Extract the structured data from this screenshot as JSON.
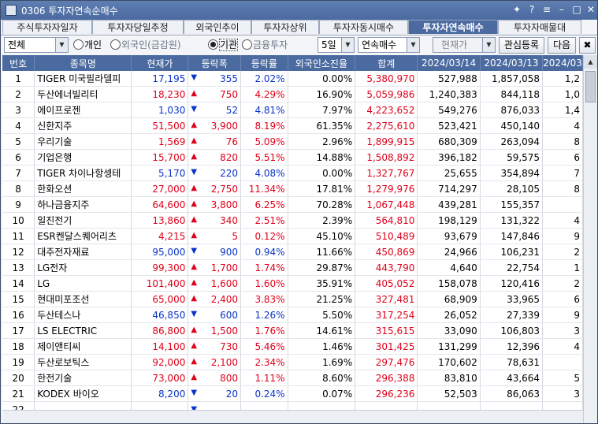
{
  "window": {
    "title": "0306 투자자연속순매수",
    "buttons": [
      "✦",
      "?",
      "≡",
      "–",
      "□",
      "✕"
    ]
  },
  "tabs": [
    {
      "label": "주식투자자일자",
      "active": false
    },
    {
      "label": "투자자당일추정",
      "active": false
    },
    {
      "label": "외국인추이",
      "active": false
    },
    {
      "label": "투자자상위",
      "active": false
    },
    {
      "label": "투자자동시매수",
      "active": false
    },
    {
      "label": "투자자연속매수",
      "active": true
    },
    {
      "label": "투자자매물대",
      "active": false
    }
  ],
  "toolbar": {
    "market_select": "전체",
    "radio_individual": "개인",
    "radio_foreign": "외국인(금감원)",
    "radio_institution": "기관",
    "radio_finance": "금융투자",
    "days_select": "5일",
    "mode_select": "연속매수",
    "price_select": "현재가",
    "watch_button": "관심등록",
    "next_button": "다음",
    "selected_radio": "institution"
  },
  "table": {
    "headers": [
      "번호",
      "종목명",
      "현재가",
      "등락폭",
      "등락률",
      "외국인소진율",
      "합계",
      "2024/03/14",
      "2024/03/13",
      "2024/03"
    ],
    "rows": [
      {
        "no": "1",
        "name": "TIGER 미국필라델피",
        "price": "17,195",
        "dir": "down",
        "chg": "355",
        "rate": "2.02%",
        "foreign": "0.00%",
        "sum": "5,380,970",
        "d1": "527,988",
        "d2": "1,857,058",
        "d3": "1,2"
      },
      {
        "no": "2",
        "name": "두산에너빌리티",
        "price": "18,230",
        "dir": "up",
        "chg": "750",
        "rate": "4.29%",
        "foreign": "16.90%",
        "sum": "5,059,986",
        "d1": "1,240,383",
        "d2": "844,118",
        "d3": "1,0"
      },
      {
        "no": "3",
        "name": "에이프로젠",
        "price": "1,030",
        "dir": "down",
        "chg": "52",
        "rate": "4.81%",
        "foreign": "7.97%",
        "sum": "4,223,652",
        "d1": "549,276",
        "d2": "876,033",
        "d3": "1,4"
      },
      {
        "no": "4",
        "name": "신한지주",
        "price": "51,500",
        "dir": "up",
        "chg": "3,900",
        "rate": "8.19%",
        "foreign": "61.35%",
        "sum": "2,275,610",
        "d1": "523,421",
        "d2": "450,140",
        "d3": "4"
      },
      {
        "no": "5",
        "name": "우리기술",
        "price": "1,569",
        "dir": "up",
        "chg": "76",
        "rate": "5.09%",
        "foreign": "2.96%",
        "sum": "1,899,915",
        "d1": "680,309",
        "d2": "263,094",
        "d3": "8"
      },
      {
        "no": "6",
        "name": "기업은행",
        "price": "15,700",
        "dir": "up",
        "chg": "820",
        "rate": "5.51%",
        "foreign": "14.88%",
        "sum": "1,508,892",
        "d1": "396,182",
        "d2": "59,575",
        "d3": "6"
      },
      {
        "no": "7",
        "name": "TIGER 차이나항셍테",
        "price": "5,170",
        "dir": "down",
        "chg": "220",
        "rate": "4.08%",
        "foreign": "0.00%",
        "sum": "1,327,767",
        "d1": "25,655",
        "d2": "354,894",
        "d3": "7"
      },
      {
        "no": "8",
        "name": "한화오션",
        "price": "27,000",
        "dir": "up",
        "chg": "2,750",
        "rate": "11.34%",
        "foreign": "17.81%",
        "sum": "1,279,976",
        "d1": "714,297",
        "d2": "28,105",
        "d3": "8"
      },
      {
        "no": "9",
        "name": "하나금융지주",
        "price": "64,600",
        "dir": "up",
        "chg": "3,800",
        "rate": "6.25%",
        "foreign": "70.28%",
        "sum": "1,067,448",
        "d1": "439,281",
        "d2": "155,357",
        "d3": ""
      },
      {
        "no": "10",
        "name": "일진전기",
        "price": "13,860",
        "dir": "up",
        "chg": "340",
        "rate": "2.51%",
        "foreign": "2.39%",
        "sum": "564,810",
        "d1": "198,129",
        "d2": "131,322",
        "d3": "4"
      },
      {
        "no": "11",
        "name": "ESR켄달스퀘어리츠",
        "price": "4,215",
        "dir": "up",
        "chg": "5",
        "rate": "0.12%",
        "foreign": "45.10%",
        "sum": "510,489",
        "d1": "93,679",
        "d2": "147,846",
        "d3": "9"
      },
      {
        "no": "12",
        "name": "대주전자재료",
        "price": "95,000",
        "dir": "down",
        "chg": "900",
        "rate": "0.94%",
        "foreign": "11.66%",
        "sum": "450,869",
        "d1": "24,966",
        "d2": "106,231",
        "d3": "2"
      },
      {
        "no": "13",
        "name": "LG전자",
        "price": "99,300",
        "dir": "up",
        "chg": "1,700",
        "rate": "1.74%",
        "foreign": "29.87%",
        "sum": "443,790",
        "d1": "4,640",
        "d2": "22,754",
        "d3": "1"
      },
      {
        "no": "14",
        "name": "LG",
        "price": "101,400",
        "dir": "up",
        "chg": "1,600",
        "rate": "1.60%",
        "foreign": "35.91%",
        "sum": "405,052",
        "d1": "158,078",
        "d2": "120,416",
        "d3": "2"
      },
      {
        "no": "15",
        "name": "현대미포조선",
        "price": "65,000",
        "dir": "up",
        "chg": "2,400",
        "rate": "3.83%",
        "foreign": "21.25%",
        "sum": "327,481",
        "d1": "68,909",
        "d2": "33,965",
        "d3": "6"
      },
      {
        "no": "16",
        "name": "두산테스나",
        "price": "46,850",
        "dir": "down",
        "chg": "600",
        "rate": "1.26%",
        "foreign": "5.50%",
        "sum": "317,254",
        "d1": "26,052",
        "d2": "27,339",
        "d3": "9"
      },
      {
        "no": "17",
        "name": "LS ELECTRIC",
        "price": "86,800",
        "dir": "up",
        "chg": "1,500",
        "rate": "1.76%",
        "foreign": "14.61%",
        "sum": "315,615",
        "d1": "33,090",
        "d2": "106,803",
        "d3": "3"
      },
      {
        "no": "18",
        "name": "제이앤티씨",
        "price": "14,100",
        "dir": "up",
        "chg": "730",
        "rate": "5.46%",
        "foreign": "1.46%",
        "sum": "301,425",
        "d1": "131,299",
        "d2": "12,396",
        "d3": "4"
      },
      {
        "no": "19",
        "name": "두산로보틱스",
        "price": "92,000",
        "dir": "up",
        "chg": "2,100",
        "rate": "2.34%",
        "foreign": "1.69%",
        "sum": "297,476",
        "d1": "170,602",
        "d2": "78,631",
        "d3": ""
      },
      {
        "no": "20",
        "name": "한전기술",
        "price": "73,000",
        "dir": "up",
        "chg": "800",
        "rate": "1.11%",
        "foreign": "8.60%",
        "sum": "296,388",
        "d1": "83,810",
        "d2": "43,664",
        "d3": "5"
      },
      {
        "no": "21",
        "name": "KODEX 바이오",
        "price": "8,200",
        "dir": "down",
        "chg": "20",
        "rate": "0.24%",
        "foreign": "0.07%",
        "sum": "296,236",
        "d1": "52,503",
        "d2": "86,063",
        "d3": "3"
      },
      {
        "no": "22",
        "name": "",
        "price": "",
        "dir": "down",
        "chg": "",
        "rate": "",
        "foreign": "",
        "sum": "",
        "d1": "",
        "d2": "",
        "d3": ""
      }
    ]
  },
  "colors": {
    "up": "#e0001a",
    "down": "#0a33c9",
    "header": "#4a6aa0"
  }
}
